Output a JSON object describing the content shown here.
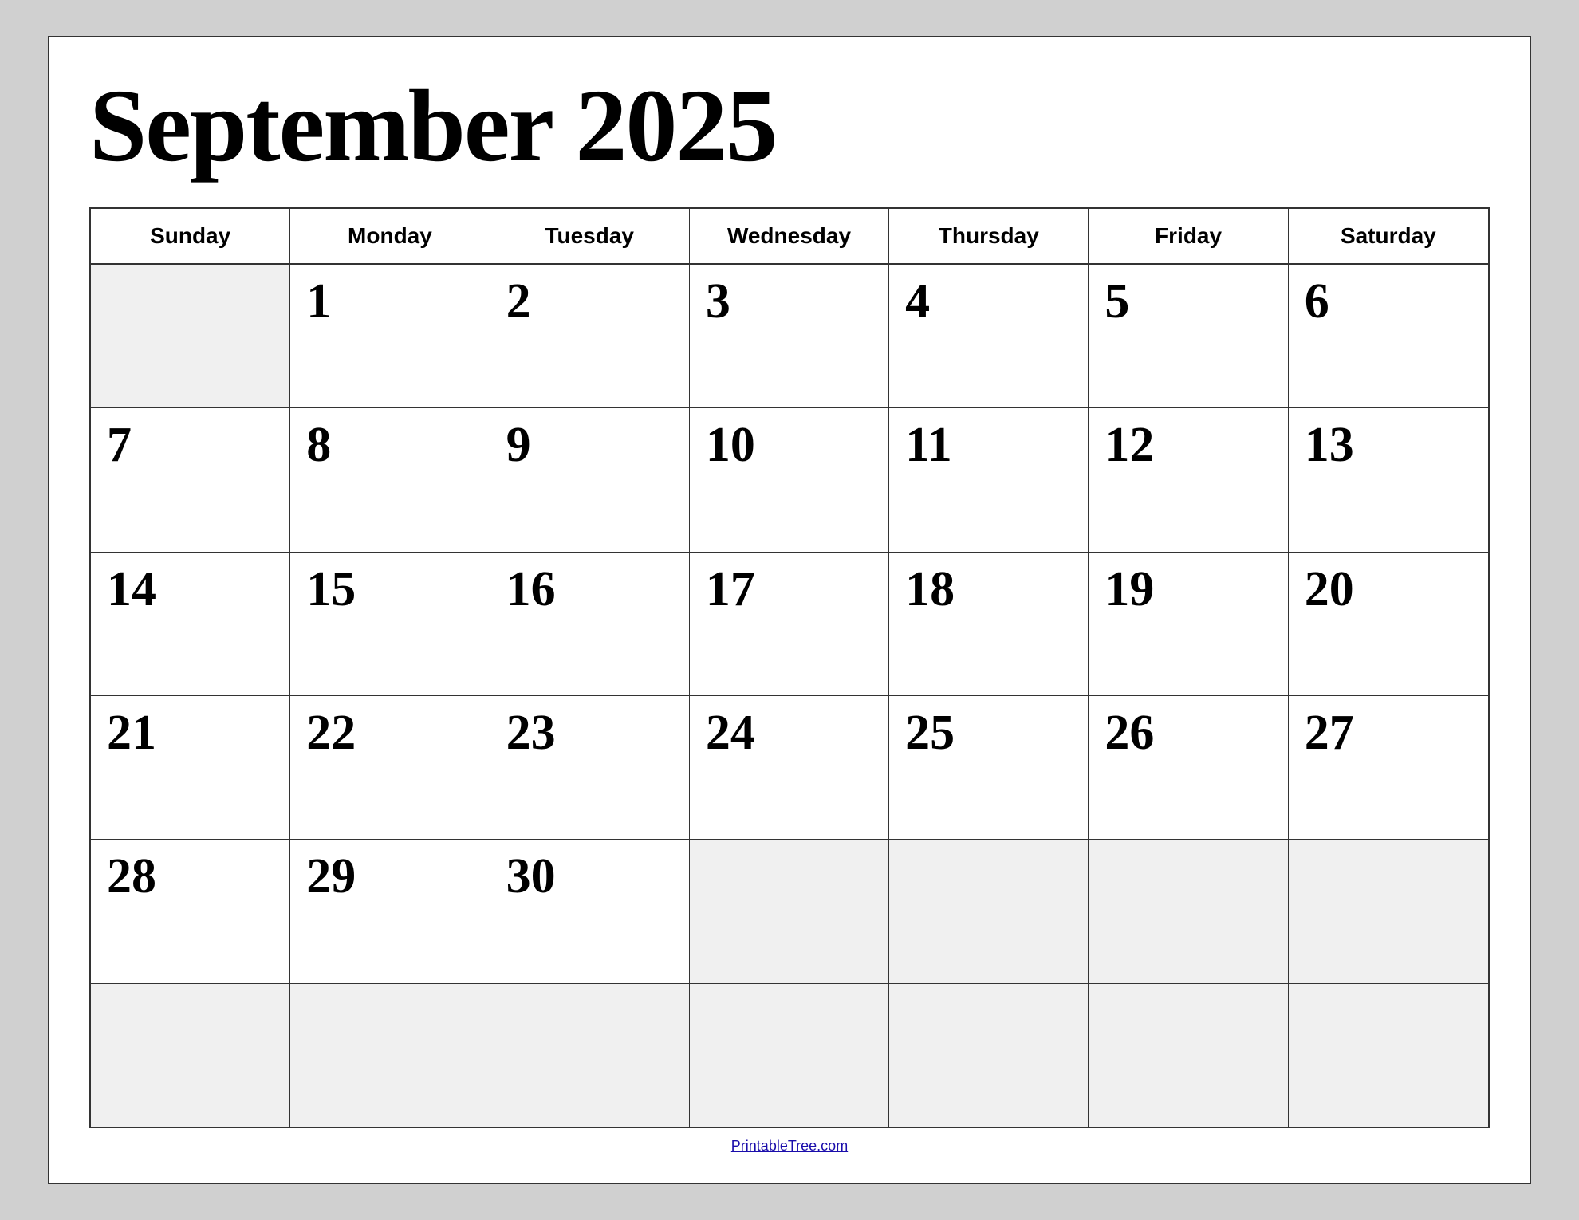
{
  "title": "September 2025",
  "headers": [
    "Sunday",
    "Monday",
    "Tuesday",
    "Wednesday",
    "Thursday",
    "Friday",
    "Saturday"
  ],
  "weeks": [
    [
      {
        "day": "",
        "empty": true
      },
      {
        "day": "1",
        "empty": false
      },
      {
        "day": "2",
        "empty": false
      },
      {
        "day": "3",
        "empty": false
      },
      {
        "day": "4",
        "empty": false
      },
      {
        "day": "5",
        "empty": false
      },
      {
        "day": "6",
        "empty": false
      }
    ],
    [
      {
        "day": "7",
        "empty": false
      },
      {
        "day": "8",
        "empty": false
      },
      {
        "day": "9",
        "empty": false
      },
      {
        "day": "10",
        "empty": false
      },
      {
        "day": "11",
        "empty": false
      },
      {
        "day": "12",
        "empty": false
      },
      {
        "day": "13",
        "empty": false
      }
    ],
    [
      {
        "day": "14",
        "empty": false
      },
      {
        "day": "15",
        "empty": false
      },
      {
        "day": "16",
        "empty": false
      },
      {
        "day": "17",
        "empty": false
      },
      {
        "day": "18",
        "empty": false
      },
      {
        "day": "19",
        "empty": false
      },
      {
        "day": "20",
        "empty": false
      }
    ],
    [
      {
        "day": "21",
        "empty": false
      },
      {
        "day": "22",
        "empty": false
      },
      {
        "day": "23",
        "empty": false
      },
      {
        "day": "24",
        "empty": false
      },
      {
        "day": "25",
        "empty": false
      },
      {
        "day": "26",
        "empty": false
      },
      {
        "day": "27",
        "empty": false
      }
    ],
    [
      {
        "day": "28",
        "empty": false
      },
      {
        "day": "29",
        "empty": false
      },
      {
        "day": "30",
        "empty": false
      },
      {
        "day": "",
        "empty": true
      },
      {
        "day": "",
        "empty": true
      },
      {
        "day": "",
        "empty": true
      },
      {
        "day": "",
        "empty": true
      }
    ],
    [
      {
        "day": "",
        "empty": true
      },
      {
        "day": "",
        "empty": true
      },
      {
        "day": "",
        "empty": true
      },
      {
        "day": "",
        "empty": true
      },
      {
        "day": "",
        "empty": true
      },
      {
        "day": "",
        "empty": true
      },
      {
        "day": "",
        "empty": true
      }
    ]
  ],
  "footer": {
    "text": "PrintableTree.com",
    "url": "https://PrintableTree.com"
  }
}
